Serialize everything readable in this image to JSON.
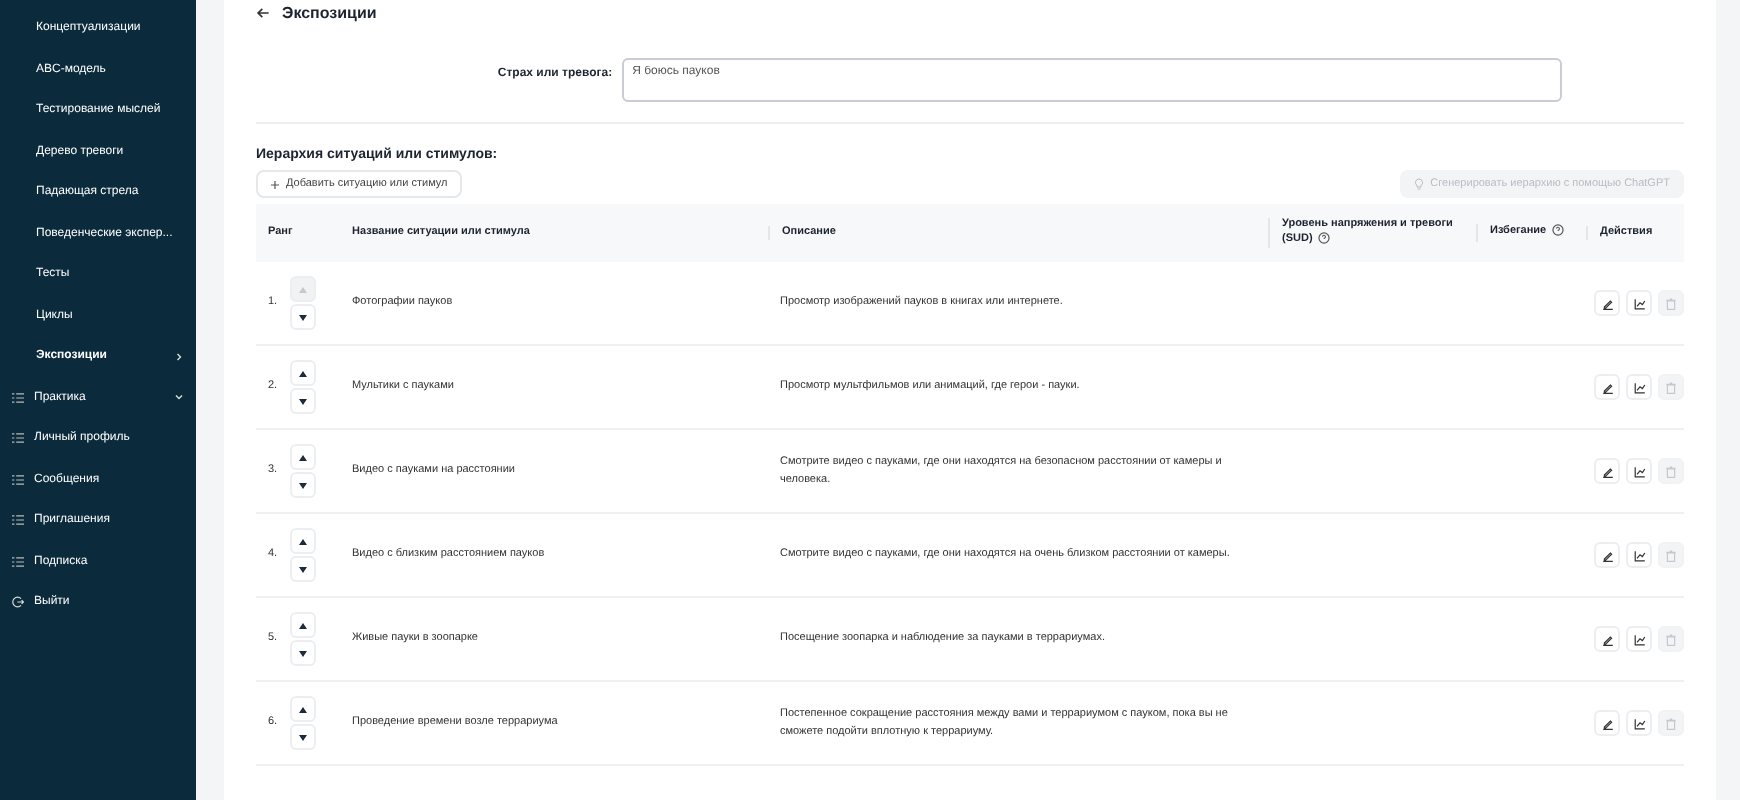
{
  "sidebar": {
    "items": [
      {
        "kind": "sub",
        "label": "Концептуализации",
        "selected": false
      },
      {
        "kind": "sub",
        "label": "ABC-модель",
        "selected": false
      },
      {
        "kind": "sub",
        "label": "Тестирование мыслей",
        "selected": false
      },
      {
        "kind": "sub",
        "label": "Дерево тревоги",
        "selected": false
      },
      {
        "kind": "sub",
        "label": "Падающая стрела",
        "selected": false
      },
      {
        "kind": "sub",
        "label": "Поведенческие экспер...",
        "selected": false
      },
      {
        "kind": "sub",
        "label": "Тесты",
        "selected": false
      },
      {
        "kind": "sub",
        "label": "Циклы",
        "selected": false
      },
      {
        "kind": "sub",
        "label": "Экспозиции",
        "selected": true
      },
      {
        "kind": "main",
        "label": "Практика",
        "expanded": true
      },
      {
        "kind": "main",
        "label": "Личный профиль"
      },
      {
        "kind": "main",
        "label": "Сообщения"
      },
      {
        "kind": "main",
        "label": "Приглашения"
      },
      {
        "kind": "main",
        "label": "Подписка"
      },
      {
        "kind": "logout",
        "label": "Выйти"
      }
    ]
  },
  "page": {
    "title": "Экспозиции"
  },
  "fear": {
    "label": "Страх или тревога:",
    "value": "Я боюсь пауков"
  },
  "hierarchy": {
    "heading": "Иерархия ситуаций или стимулов:",
    "add_button": "Добавить ситуацию или стимул",
    "generate_button": {
      "label": "Сгенерировать иерархию с помощью ChatGPT",
      "disabled": true
    }
  },
  "table": {
    "columns": [
      {
        "label": "Ранг"
      },
      {
        "label": "Название ситуации или стимула"
      },
      {
        "label": "Описание"
      },
      {
        "label": "Уровень напряжения и тревоги (SUD)",
        "help": true
      },
      {
        "label": "Избегание",
        "help": true
      },
      {
        "label": "Действия"
      }
    ],
    "rows": [
      {
        "rank": "1.",
        "name": "Фотографии пауков",
        "description": "Просмотр изображений пауков в книгах или интернете.",
        "up_disabled": true
      },
      {
        "rank": "2.",
        "name": "Мультики с пауками",
        "description": "Просмотр мультфильмов или анимаций, где герои - пауки.",
        "up_disabled": false
      },
      {
        "rank": "3.",
        "name": "Видео с пауками на расстоянии",
        "description": "Смотрите видео с пауками, где они находятся на безопасном расстоянии от камеры и человека.",
        "up_disabled": false
      },
      {
        "rank": "4.",
        "name": "Видео с близким расстоянием пауков",
        "description": "Смотрите видео с пауками, где они находятся на очень близком расстоянии от камеры.",
        "up_disabled": false
      },
      {
        "rank": "5.",
        "name": "Живые пауки в зоопарке",
        "description": "Посещение зоопарка и наблюдение за пауками в террариумах.",
        "up_disabled": false
      },
      {
        "rank": "6.",
        "name": "Проведение времени возле террариума",
        "description": "Постепенное сокращение расстояния между вами и террариумом с пауком, пока вы не сможете подойти вплотную к террариуму.",
        "up_disabled": false
      }
    ]
  }
}
